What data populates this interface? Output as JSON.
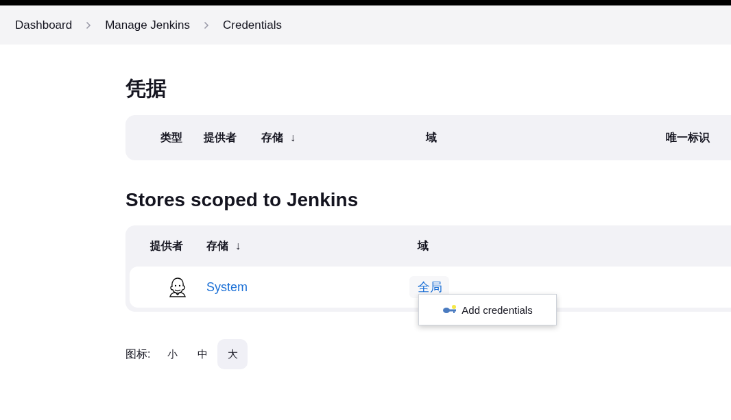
{
  "breadcrumbs": [
    {
      "label": "Dashboard"
    },
    {
      "label": "Manage Jenkins"
    },
    {
      "label": "Credentials"
    }
  ],
  "title": "凭据",
  "credentials_table": {
    "columns": [
      {
        "label": "类型"
      },
      {
        "label": "提供者"
      },
      {
        "label": "存储",
        "sort": "↓"
      },
      {
        "label": "域"
      },
      {
        "label": "唯一标识"
      }
    ]
  },
  "stores_heading": "Stores scoped to Jenkins",
  "stores_table": {
    "columns": [
      {
        "label": "提供者"
      },
      {
        "label": "存储",
        "sort": "↓"
      },
      {
        "label": "域"
      }
    ],
    "rows": [
      {
        "store": "System",
        "domain": "全局"
      }
    ]
  },
  "dropdown_menu": {
    "items": [
      {
        "label": "Add credentials"
      }
    ]
  },
  "icon_size": {
    "label": "图标:",
    "options": [
      {
        "label": "小",
        "selected": false
      },
      {
        "label": "中",
        "selected": false
      },
      {
        "label": "大",
        "selected": true
      }
    ]
  }
}
